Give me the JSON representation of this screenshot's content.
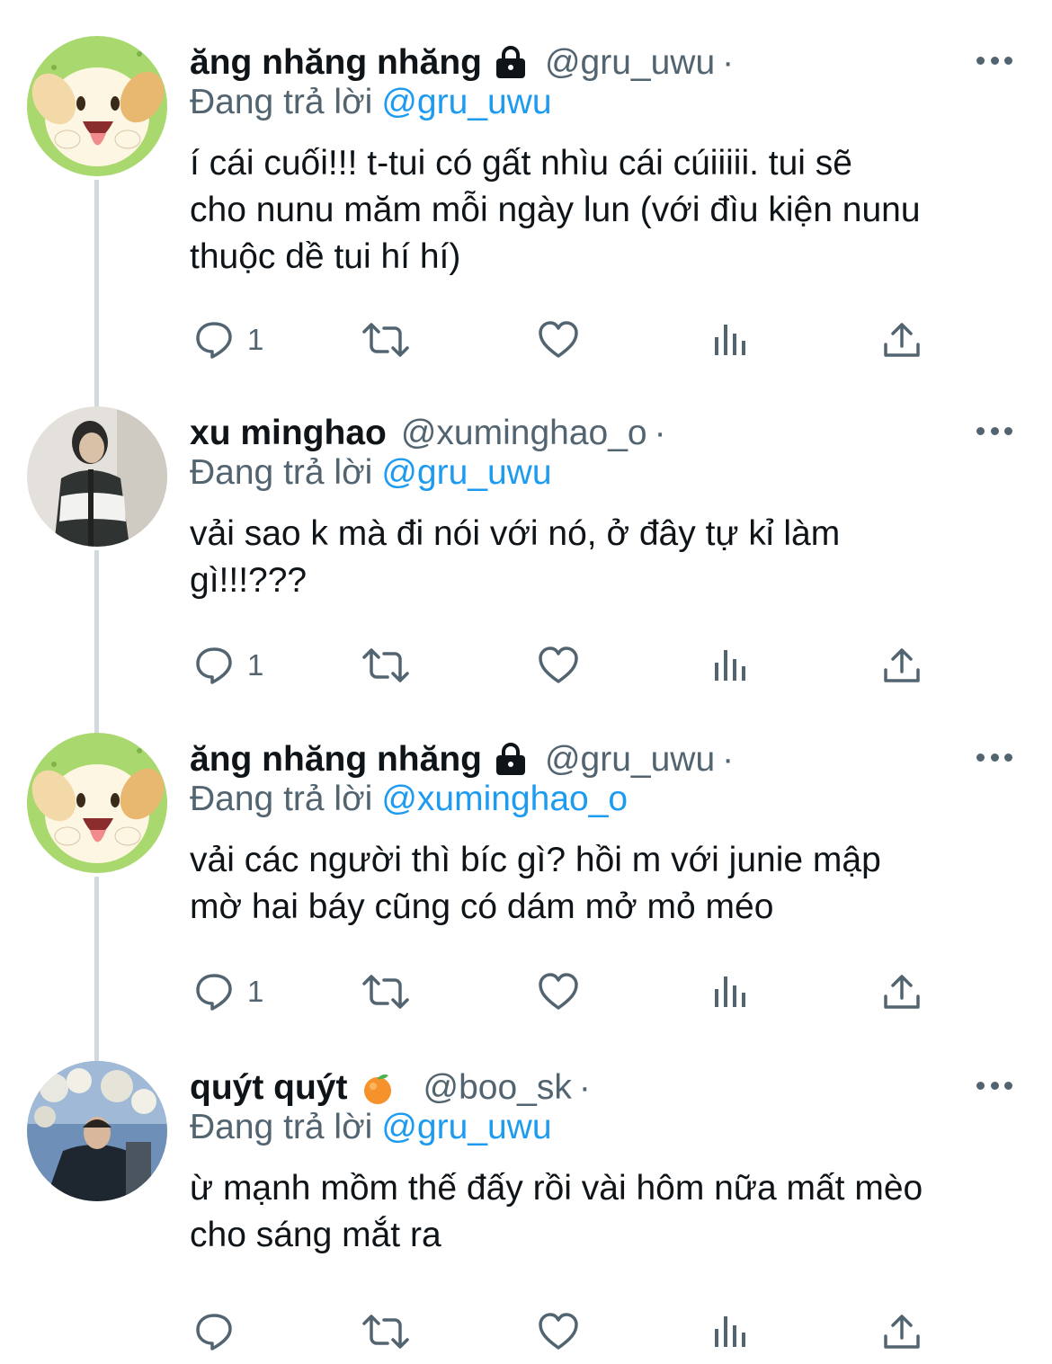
{
  "replying_label": "Đang trả lời",
  "tweets": [
    {
      "display_name": "ăng nhăng nhăng",
      "badge_icon": "lock-icon",
      "handle": "@gru_uwu",
      "separator": "·",
      "replying_to": "@gru_uwu",
      "text": "í cái cuối!!! t-tui có gất nhìu cái cúiiiii. tui sẽ\ncho nunu măm mỗi ngày lun (với đìu kiện nunu\nthuộc dề tui hí hí)",
      "reply_count": "1"
    },
    {
      "display_name": "xu minghao",
      "badge_icon": "",
      "handle": "@xuminghao_o",
      "separator": "·",
      "replying_to": "@gru_uwu",
      "text": "vải sao k mà đi nói với nó, ở đây tự kỉ làm\ngì!!!???",
      "reply_count": "1"
    },
    {
      "display_name": "ăng nhăng nhăng",
      "badge_icon": "lock-icon",
      "handle": "@gru_uwu",
      "separator": "·",
      "replying_to": "@xuminghao_o",
      "text": "vải các người thì bíc gì? hồi m với junie mập\nmờ hai báy cũng có dám mở mỏ méo",
      "reply_count": "1"
    },
    {
      "display_name": "quýt quýt",
      "badge_icon": "tangerine-emoji-icon",
      "handle": "@boo_sk",
      "separator": "·",
      "replying_to": "@gru_uwu",
      "text": "ừ mạnh mồm thế đấy rồi vài hôm nữa mất mèo\ncho sáng mắt ra",
      "reply_count": ""
    }
  ],
  "colors": {
    "text": "#0f1419",
    "secondary": "#536471",
    "link": "#1d9bf0",
    "thread_line": "#cfd9de"
  }
}
